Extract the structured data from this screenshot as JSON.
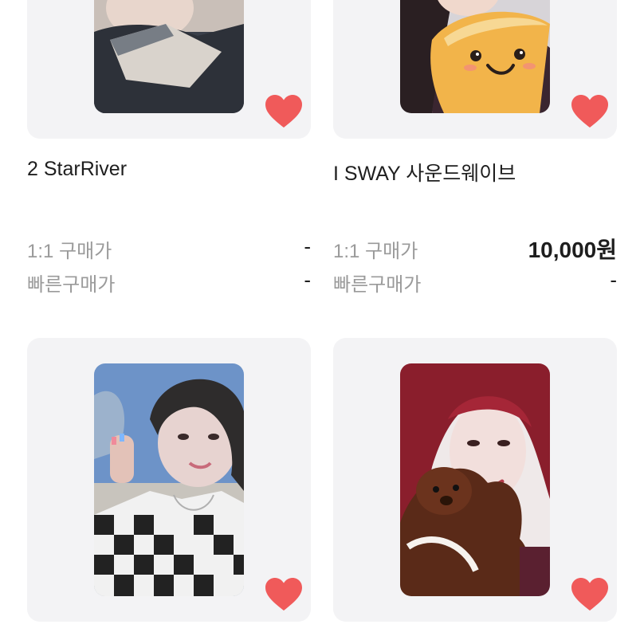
{
  "products": [
    {
      "title": "2 StarRiver",
      "price_label_1": "1:1 구매가",
      "price_value_1": "-",
      "price_label_2": "빠른구매가",
      "price_value_2": "-",
      "liked": true
    },
    {
      "title": "I SWAY 사운드웨이브",
      "price_label_1": "1:1 구매가",
      "price_value_1": "10,000원",
      "price_label_2": "빠른구매가",
      "price_value_2": "-",
      "liked": true
    },
    {
      "liked": true
    },
    {
      "liked": true
    }
  ],
  "colors": {
    "heart": "#f05a5a",
    "card_bg": "#f3f3f5",
    "muted_text": "#9a9a9a"
  }
}
